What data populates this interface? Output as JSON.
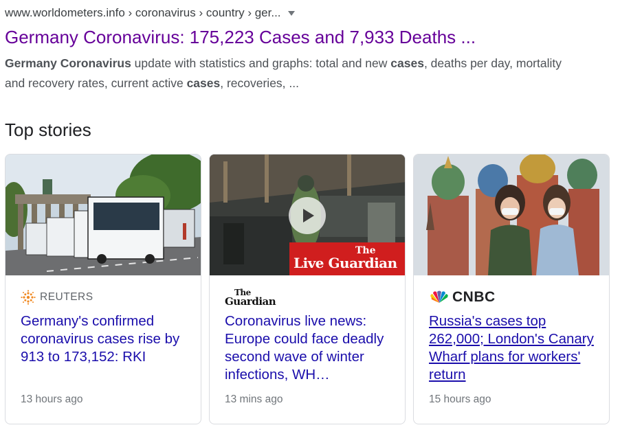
{
  "result": {
    "cite": "www.worldometers.info › coronavirus › country › ger...",
    "title": "Germany Coronavirus: 175,223 Cases and 7,933 Deaths ...",
    "snippet": {
      "b1": "Germany Coronavirus",
      "t1": " update with statistics and graphs: total and new ",
      "b2": "cases",
      "t2": ", deaths per day, mortality and recovery rates, current active ",
      "b3": "cases",
      "t3": ", recoveries, ..."
    }
  },
  "top_stories": {
    "heading": "Top stories",
    "cards": [
      {
        "publisher": "REUTERS",
        "publisher_icon": "reuters-logo-icon",
        "headline": "Germany's confirmed coronavirus cases rise by 913 to 173,152: RKI",
        "time": "13 hours ago"
      },
      {
        "publisher_the": "The",
        "publisher_name": "Guardian",
        "publisher_icon": "guardian-logo-icon",
        "headline": "Coronavirus live news: Europe could face deadly second wave of winter infections, WH…",
        "time": "13 mins ago",
        "overlay_the": "The",
        "overlay_text": "Live Guardian",
        "play_icon": "play-icon"
      },
      {
        "publisher": "CNBC",
        "publisher_icon": "nbc-peacock-icon",
        "headline": "Russia's cases top 262,000; London's Canary Wharf plans for workers' return",
        "time": "15 hours ago"
      }
    ]
  },
  "colors": {
    "visited_title": "#660099",
    "link": "#1a0dab",
    "meta": "#70757a",
    "guardian_red": "#d01e1e"
  }
}
